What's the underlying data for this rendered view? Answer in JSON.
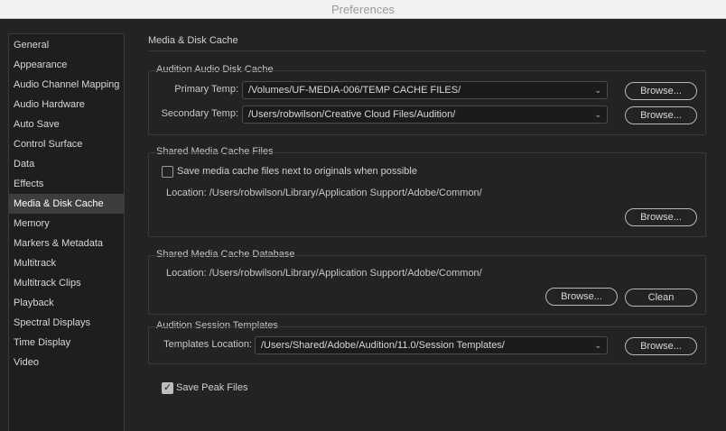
{
  "window": {
    "title": "Preferences"
  },
  "sidebar": {
    "items": [
      {
        "label": "General"
      },
      {
        "label": "Appearance"
      },
      {
        "label": "Audio Channel Mapping"
      },
      {
        "label": "Audio Hardware"
      },
      {
        "label": "Auto Save"
      },
      {
        "label": "Control Surface"
      },
      {
        "label": "Data"
      },
      {
        "label": "Effects"
      },
      {
        "label": "Media & Disk Cache",
        "selected": true
      },
      {
        "label": "Memory"
      },
      {
        "label": "Markers & Metadata"
      },
      {
        "label": "Multitrack"
      },
      {
        "label": "Multitrack Clips"
      },
      {
        "label": "Playback"
      },
      {
        "label": "Spectral Displays"
      },
      {
        "label": "Time Display"
      },
      {
        "label": "Video"
      }
    ]
  },
  "main": {
    "title": "Media & Disk Cache",
    "disk_cache": {
      "title": "Audition Audio Disk Cache",
      "primary_label": "Primary Temp:",
      "primary_value": "/Volumes/UF-MEDIA-006/TEMP CACHE FILES/",
      "secondary_label": "Secondary Temp:",
      "secondary_value": "/Users/robwilson/Creative Cloud Files/Audition/",
      "browse_label": "Browse..."
    },
    "shared_files": {
      "title": "Shared Media Cache Files",
      "checkbox_label": "Save media cache files next to originals when possible",
      "checkbox_checked": false,
      "location": "Location: /Users/robwilson/Library/Application Support/Adobe/Common/",
      "browse_label": "Browse..."
    },
    "shared_db": {
      "title": "Shared Media Cache Database",
      "location": "Location: /Users/robwilson/Library/Application Support/Adobe/Common/",
      "browse_label": "Browse...",
      "clean_label": "Clean"
    },
    "templates": {
      "title": "Audition Session Templates",
      "location_label": "Templates Location:",
      "location_value": "/Users/Shared/Adobe/Audition/11.0/Session Templates/",
      "browse_label": "Browse..."
    },
    "peak_files": {
      "label": "Save Peak Files",
      "checked": true
    }
  }
}
